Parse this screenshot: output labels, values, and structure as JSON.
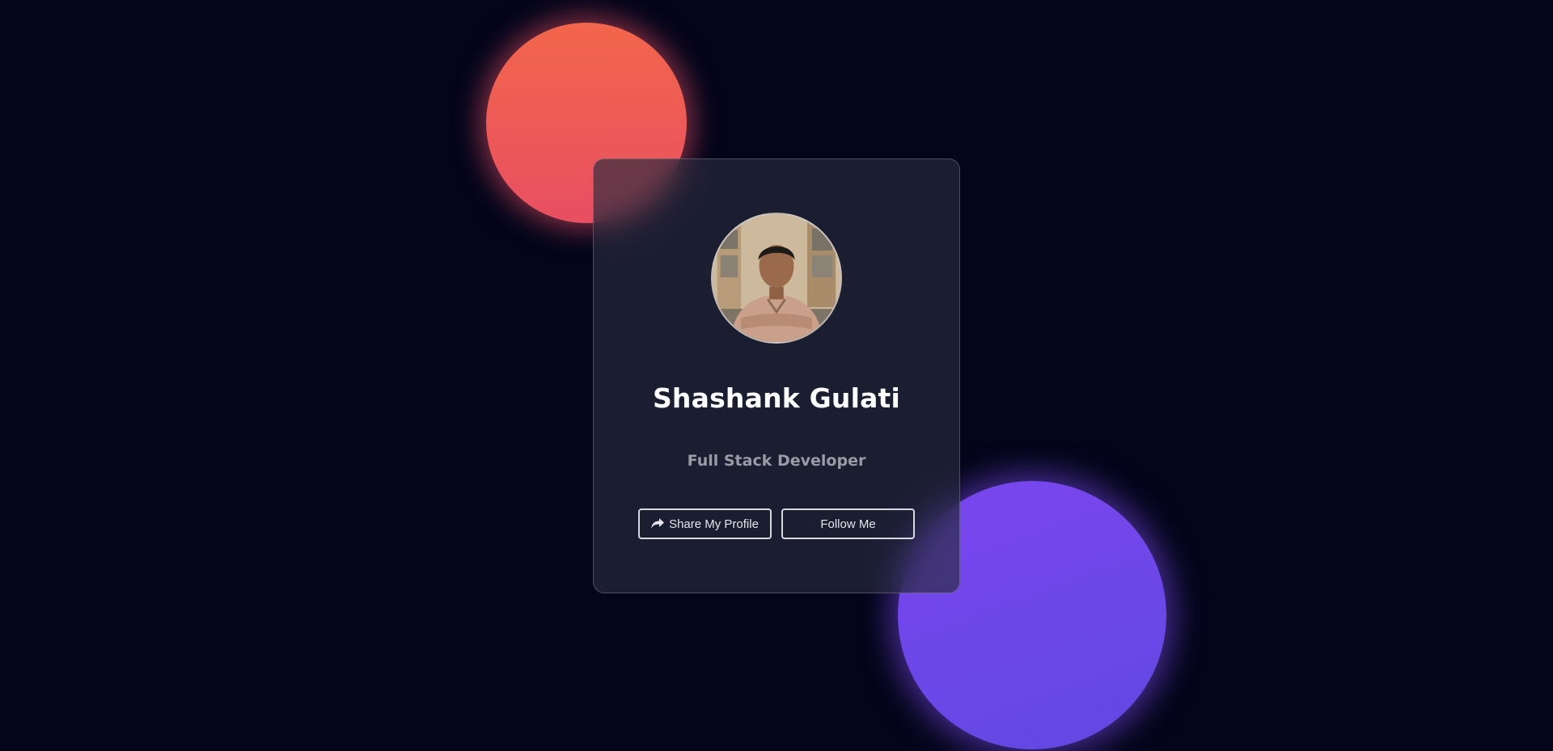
{
  "profile": {
    "name": "Shashank Gulati",
    "role": "Full Stack Developer"
  },
  "actions": {
    "share_label": "Share My Profile",
    "share_icon": "share-icon",
    "follow_label": "Follow Me"
  },
  "colors": {
    "background": "#04051a",
    "orb_orange": "#f2664b",
    "orb_purple": "#7b45ef",
    "card": "#282a3e"
  }
}
